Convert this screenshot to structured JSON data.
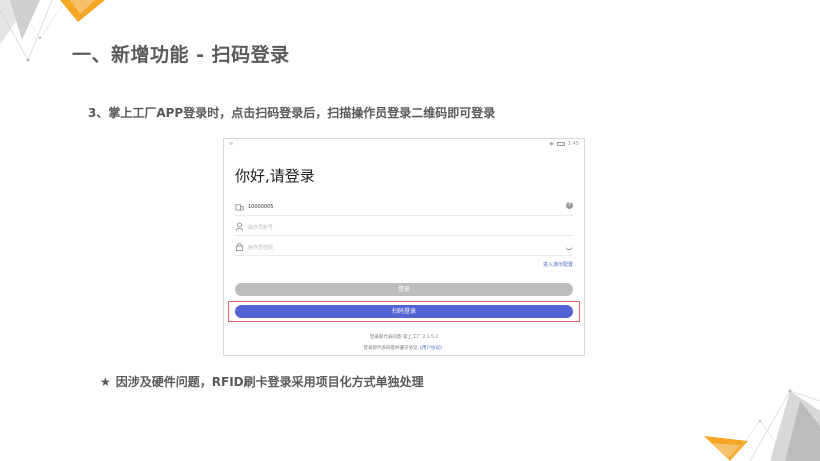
{
  "slide": {
    "title": "一、新增功能 - 扫码登录",
    "step": "3、掌上工厂APP登录时，点击扫码登录后，扫描操作员登录二维码即可登录",
    "note_star": "★",
    "note": "因涉及硬件问题，RFID刷卡登录采用项目化方式单独处理"
  },
  "phone": {
    "status_time": "1:45",
    "greeting": "你好,请登录",
    "account_value": "10000005",
    "operator_placeholder": "操作员账号",
    "password_placeholder": "操作员密码",
    "demo_link": "进入演示配置",
    "login_button": "登录",
    "scan_login_button": "扫码登录",
    "footer_version": "登录即代表同意-掌上工厂 2.1.5.2",
    "footer_agreement_prefix": "登录即代表同意并遵守协议",
    "footer_agreement_link": "《用户协议》"
  },
  "icons": {
    "account": "building-icon",
    "operator": "user-icon",
    "password": "lock-icon",
    "help": "question-circle-icon",
    "eye": "eye-closed-icon"
  },
  "colors": {
    "accent": "#5263d4",
    "highlight": "#e06672",
    "disabled": "#bdbdbd",
    "deco_orange": "#f5a623"
  }
}
